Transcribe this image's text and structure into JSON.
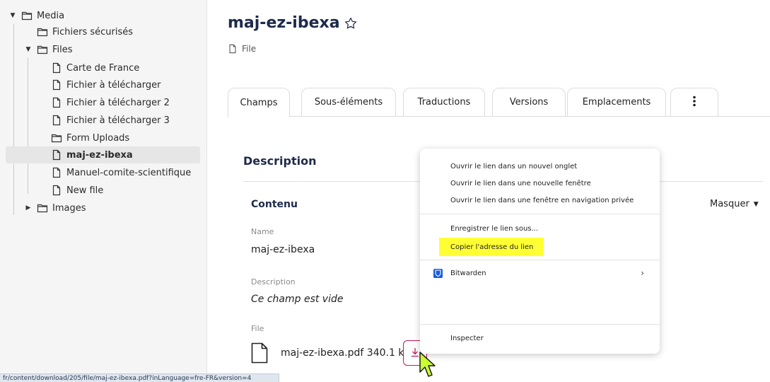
{
  "sidebar": {
    "items": [
      {
        "label": "Media"
      },
      {
        "label": "Fichiers sécurisés"
      },
      {
        "label": "Files"
      },
      {
        "label": "Carte de France"
      },
      {
        "label": "Fichier à télécharger"
      },
      {
        "label": "Fichier à télécharger 2"
      },
      {
        "label": "Fichier à télécharger 3"
      },
      {
        "label": "Form Uploads"
      },
      {
        "label": "maj-ez-ibexa"
      },
      {
        "label": "Manuel-comite-scientifique"
      },
      {
        "label": "New file"
      },
      {
        "label": "Images"
      }
    ]
  },
  "header": {
    "title": "maj-ez-ibexa",
    "content_type": "File"
  },
  "tabs": [
    {
      "label": "Champs"
    },
    {
      "label": "Sous-éléments"
    },
    {
      "label": "Traductions"
    },
    {
      "label": "Versions"
    },
    {
      "label": "Emplacements"
    }
  ],
  "main": {
    "section_title": "Description",
    "group_title": "Contenu",
    "toggle_label": "Masquer",
    "fields": {
      "name_label": "Name",
      "name_value": "maj-ez-ibexa",
      "description_label": "Description",
      "description_value": "Ce champ est vide",
      "file_label": "File",
      "file_value": "maj-ez-ibexa.pdf 340.1 kB"
    }
  },
  "context_menu": {
    "items": {
      "open_tab": "Ouvrir le lien dans un nouvel onglet",
      "open_window": "Ouvrir le lien dans une nouvelle fenêtre",
      "open_private": "Ouvrir le lien dans une fenêtre en navigation privée",
      "save_link": "Enregistrer le lien sous...",
      "copy_link": "Copier l'adresse du lien",
      "bitwarden": "Bitwarden",
      "inspect": "Inspecter"
    },
    "highlight_color": "#ffff33"
  },
  "statusbar": {
    "url": "fr/content/download/205/file/maj-ez-ibexa.pdf?inLanguage=fre-FR&version=4"
  },
  "colors": {
    "title": "#1d2a4a",
    "download_border": "#c2185b",
    "bitwarden": "#175ddc",
    "cursor_fill": "#ccff33"
  }
}
